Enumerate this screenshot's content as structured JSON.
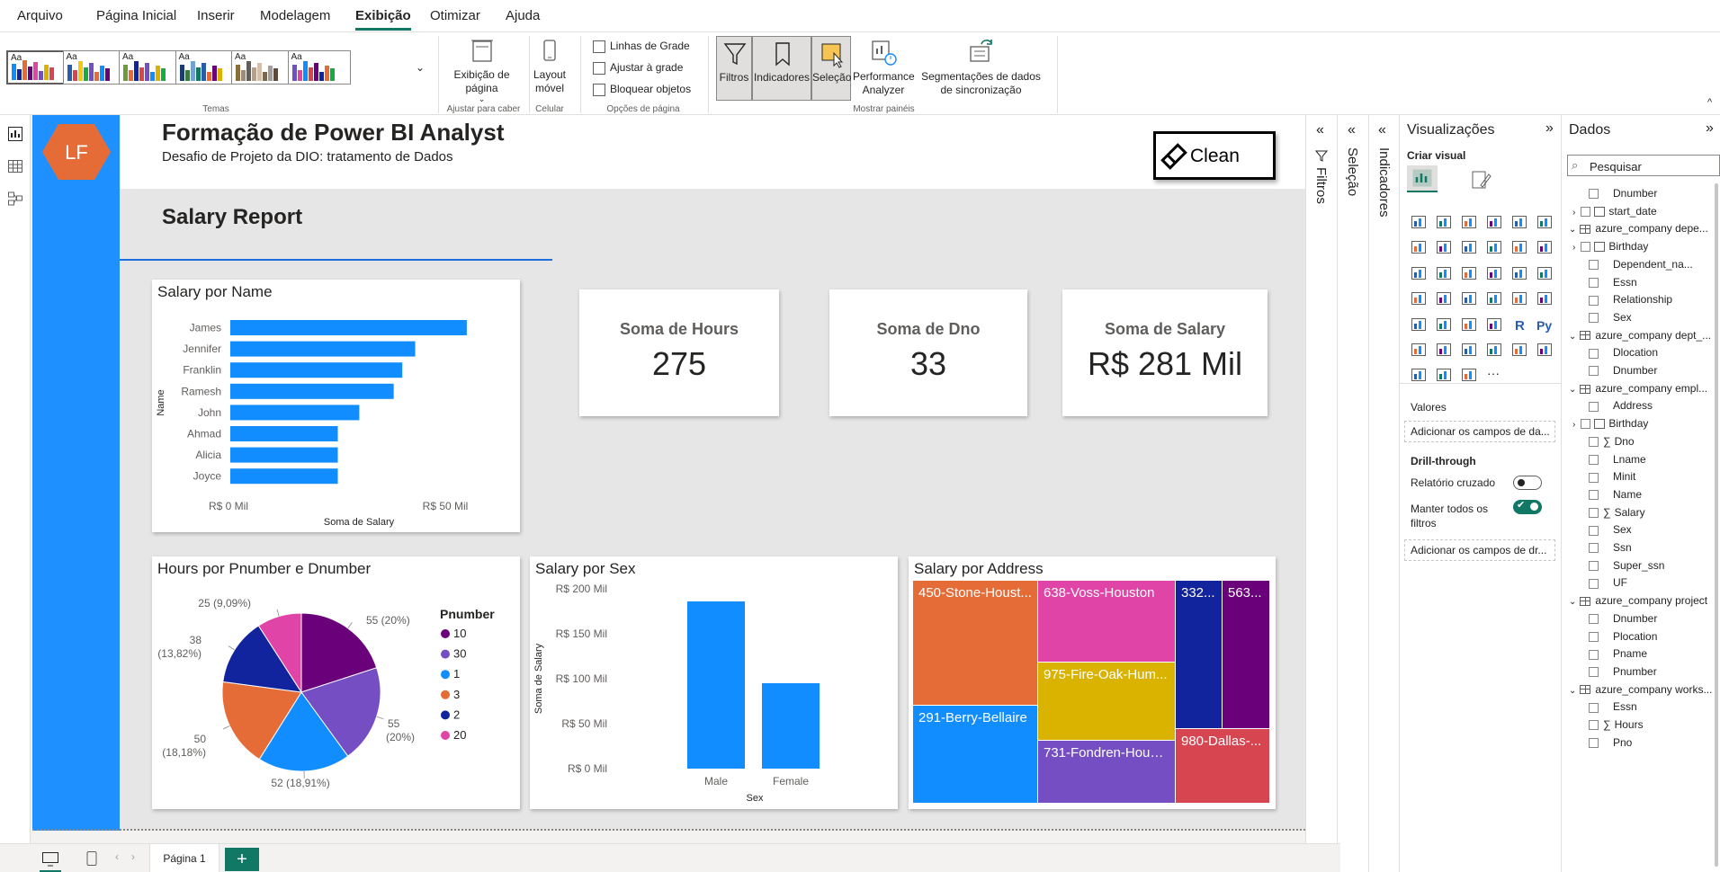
{
  "menu": {
    "items": [
      "Arquivo",
      "Página Inicial",
      "Inserir",
      "Modelagem",
      "Exibição",
      "Otimizar",
      "Ajuda"
    ],
    "active": "Exibição"
  },
  "ribbon": {
    "themes_label": "Temas",
    "page_view_label": "Exibição de página",
    "fit_label": "Ajustar para caber",
    "mobile_label": "Layout móvel",
    "celular_label": "Celular",
    "gridlines": "Linhas de Grade",
    "snap": "Ajustar à grade",
    "lock": "Bloquear objetos",
    "page_options_label": "Opções de página",
    "filters": "Filtros",
    "bookmarks": "Indicadores",
    "selection": "Seleção",
    "perf_analyzer": "Performance Analyzer",
    "sync_slicers": "Segmentações de dados de sincronização",
    "show_panes_label": "Mostrar painéis"
  },
  "report": {
    "logo": "LF",
    "title": "Formação de Power BI Analyst",
    "subtitle": "Desafio de Projeto da DIO: tratamento de Dados",
    "clean_button": "Clean",
    "section_title": "Salary Report"
  },
  "kpis": [
    {
      "label": "Soma de Hours",
      "value": "275"
    },
    {
      "label": "Soma de Dno",
      "value": "33"
    },
    {
      "label": "Soma de Salary",
      "value": "R$ 281 Mil"
    }
  ],
  "chart_data": [
    {
      "type": "bar",
      "orientation": "horizontal",
      "title": "Salary por Name",
      "ylabel": "Name",
      "xlabel": "Soma de Salary",
      "xticks": [
        "R$ 0 Mil",
        "R$ 50 Mil"
      ],
      "categories": [
        "James",
        "Jennifer",
        "Franklin",
        "Ramesh",
        "John",
        "Ahmad",
        "Alicia",
        "Joyce"
      ],
      "values": [
        55,
        43,
        40,
        38,
        30,
        25,
        25,
        25
      ],
      "xlim": [
        0,
        50
      ],
      "color": "#118dff"
    },
    {
      "type": "pie",
      "title": "Hours por Pnumber e Dnumber",
      "legend_title": "Pnumber",
      "categories": [
        "10",
        "30",
        "1",
        "3",
        "2",
        "20"
      ],
      "values": [
        55,
        55,
        52,
        50,
        38,
        25
      ],
      "labels": [
        "55 (20%)",
        "55 (20%)",
        "52 (18,91%)",
        "50 (18,18%)",
        "38 (13,82%)",
        "25 (9,09%)"
      ],
      "colors": [
        "#6b007b",
        "#744ec2",
        "#118dff",
        "#e66c37",
        "#12239e",
        "#e044a7"
      ]
    },
    {
      "type": "bar",
      "title": "Salary por Sex",
      "xlabel": "Sex",
      "ylabel": "Soma de Salary",
      "categories": [
        "Male",
        "Female"
      ],
      "values": [
        186,
        95
      ],
      "yticks": [
        "R$ 200 Mil",
        "R$ 150 Mil",
        "R$ 100 Mil",
        "R$ 50 Mil",
        "R$ 0 Mil"
      ],
      "ylim": [
        0,
        200
      ],
      "color": "#118dff"
    },
    {
      "type": "treemap",
      "title": "Salary por Address",
      "items": [
        "450-Stone-Houst...",
        "638-Voss-Houston",
        "332...",
        "563...",
        "975-Fire-Oak-Hum...",
        "291-Berry-Bellaire",
        "731-Fondren-Houst...",
        "980-Dallas-..."
      ]
    }
  ],
  "panes": {
    "filters": "Filtros",
    "selection": "Seleção",
    "bookmarks": "Indicadores",
    "visualizations": {
      "title": "Visualizações",
      "build": "Criar visual",
      "values_label": "Valores",
      "add_fields": "Adicionar os campos de da...",
      "drill_label": "Drill-through",
      "cross_report": "Relatório cruzado",
      "keep_filters": "Manter todos os filtros",
      "add_drill": "Adicionar os campos de dr...",
      "r_icon": "R",
      "py_icon": "Py",
      "more": "···"
    },
    "data": {
      "title": "Dados",
      "search_placeholder": "Pesquisar",
      "rows": [
        {
          "kind": "field",
          "text": "Dnumber"
        },
        {
          "kind": "field-exp",
          "text": "start_date"
        },
        {
          "kind": "table",
          "text": "azure_company depe..."
        },
        {
          "kind": "field-exp",
          "text": "Birthday"
        },
        {
          "kind": "field",
          "text": "Dependent_na..."
        },
        {
          "kind": "field",
          "text": "Essn"
        },
        {
          "kind": "field",
          "text": "Relationship"
        },
        {
          "kind": "field",
          "text": "Sex"
        },
        {
          "kind": "table",
          "text": "azure_company dept_..."
        },
        {
          "kind": "field",
          "text": "Dlocation"
        },
        {
          "kind": "field",
          "text": "Dnumber"
        },
        {
          "kind": "table",
          "text": "azure_company empl..."
        },
        {
          "kind": "field",
          "text": "Address"
        },
        {
          "kind": "field-exp",
          "text": "Birthday"
        },
        {
          "kind": "sum",
          "text": "Dno"
        },
        {
          "kind": "field",
          "text": "Lname"
        },
        {
          "kind": "field",
          "text": "Minit"
        },
        {
          "kind": "field",
          "text": "Name"
        },
        {
          "kind": "sum",
          "text": "Salary"
        },
        {
          "kind": "field",
          "text": "Sex"
        },
        {
          "kind": "field",
          "text": "Ssn"
        },
        {
          "kind": "field",
          "text": "Super_ssn"
        },
        {
          "kind": "field",
          "text": "UF"
        },
        {
          "kind": "table",
          "text": "azure_company project"
        },
        {
          "kind": "field",
          "text": "Dnumber"
        },
        {
          "kind": "field",
          "text": "Plocation"
        },
        {
          "kind": "field",
          "text": "Pname"
        },
        {
          "kind": "field",
          "text": "Pnumber"
        },
        {
          "kind": "table",
          "text": "azure_company works..."
        },
        {
          "kind": "field",
          "text": "Essn"
        },
        {
          "kind": "sum",
          "text": "Hours"
        },
        {
          "kind": "field",
          "text": "Pno"
        }
      ]
    }
  },
  "bottom": {
    "page_tab": "Página 1",
    "add_page": "+"
  }
}
